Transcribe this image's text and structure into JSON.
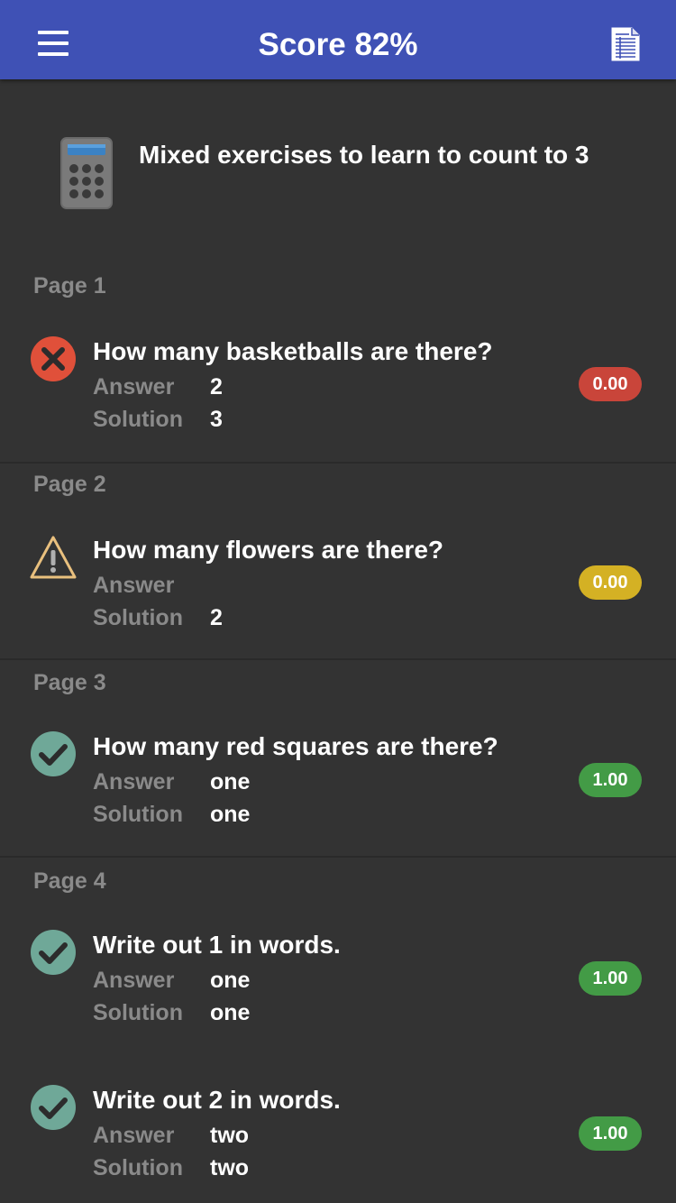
{
  "header": {
    "title": "Score 82%",
    "menu_icon": "hamburger-menu-icon",
    "report_icon": "document-icon",
    "color": "#3f51b5"
  },
  "quiz": {
    "icon": "calculator-icon",
    "title": "Mixed exercises to learn to count to 3"
  },
  "labels": {
    "answer": "Answer",
    "solution": "Solution"
  },
  "colors": {
    "background": "#333333",
    "wrong": "#e0503a",
    "partial": "#d4b124",
    "correct": "#439b46",
    "check_circle": "#6fa898",
    "muted_text": "#8a8a8a"
  },
  "pages": [
    {
      "label": "Page 1",
      "questions": [
        {
          "status": "wrong",
          "icon": "cross-circle-icon",
          "question": "How many basketballs are there?",
          "answer": "2",
          "solution": "3",
          "score": "0.00"
        }
      ]
    },
    {
      "label": "Page 2",
      "questions": [
        {
          "status": "warning",
          "icon": "warning-triangle-icon",
          "question": "How many flowers are there?",
          "answer": "",
          "solution": "2",
          "score": "0.00"
        }
      ]
    },
    {
      "label": "Page 3",
      "questions": [
        {
          "status": "correct",
          "icon": "check-circle-icon",
          "question": "How many red squares are there?",
          "answer": "one",
          "solution": "one",
          "score": "1.00"
        }
      ]
    },
    {
      "label": "Page 4",
      "questions": [
        {
          "status": "correct",
          "icon": "check-circle-icon",
          "question": "Write out 1 in words.",
          "answer": "one",
          "solution": "one",
          "score": "1.00"
        },
        {
          "status": "correct",
          "icon": "check-circle-icon",
          "question": "Write out 2 in words.",
          "answer": "two",
          "solution": "two",
          "score": "1.00"
        }
      ]
    }
  ]
}
